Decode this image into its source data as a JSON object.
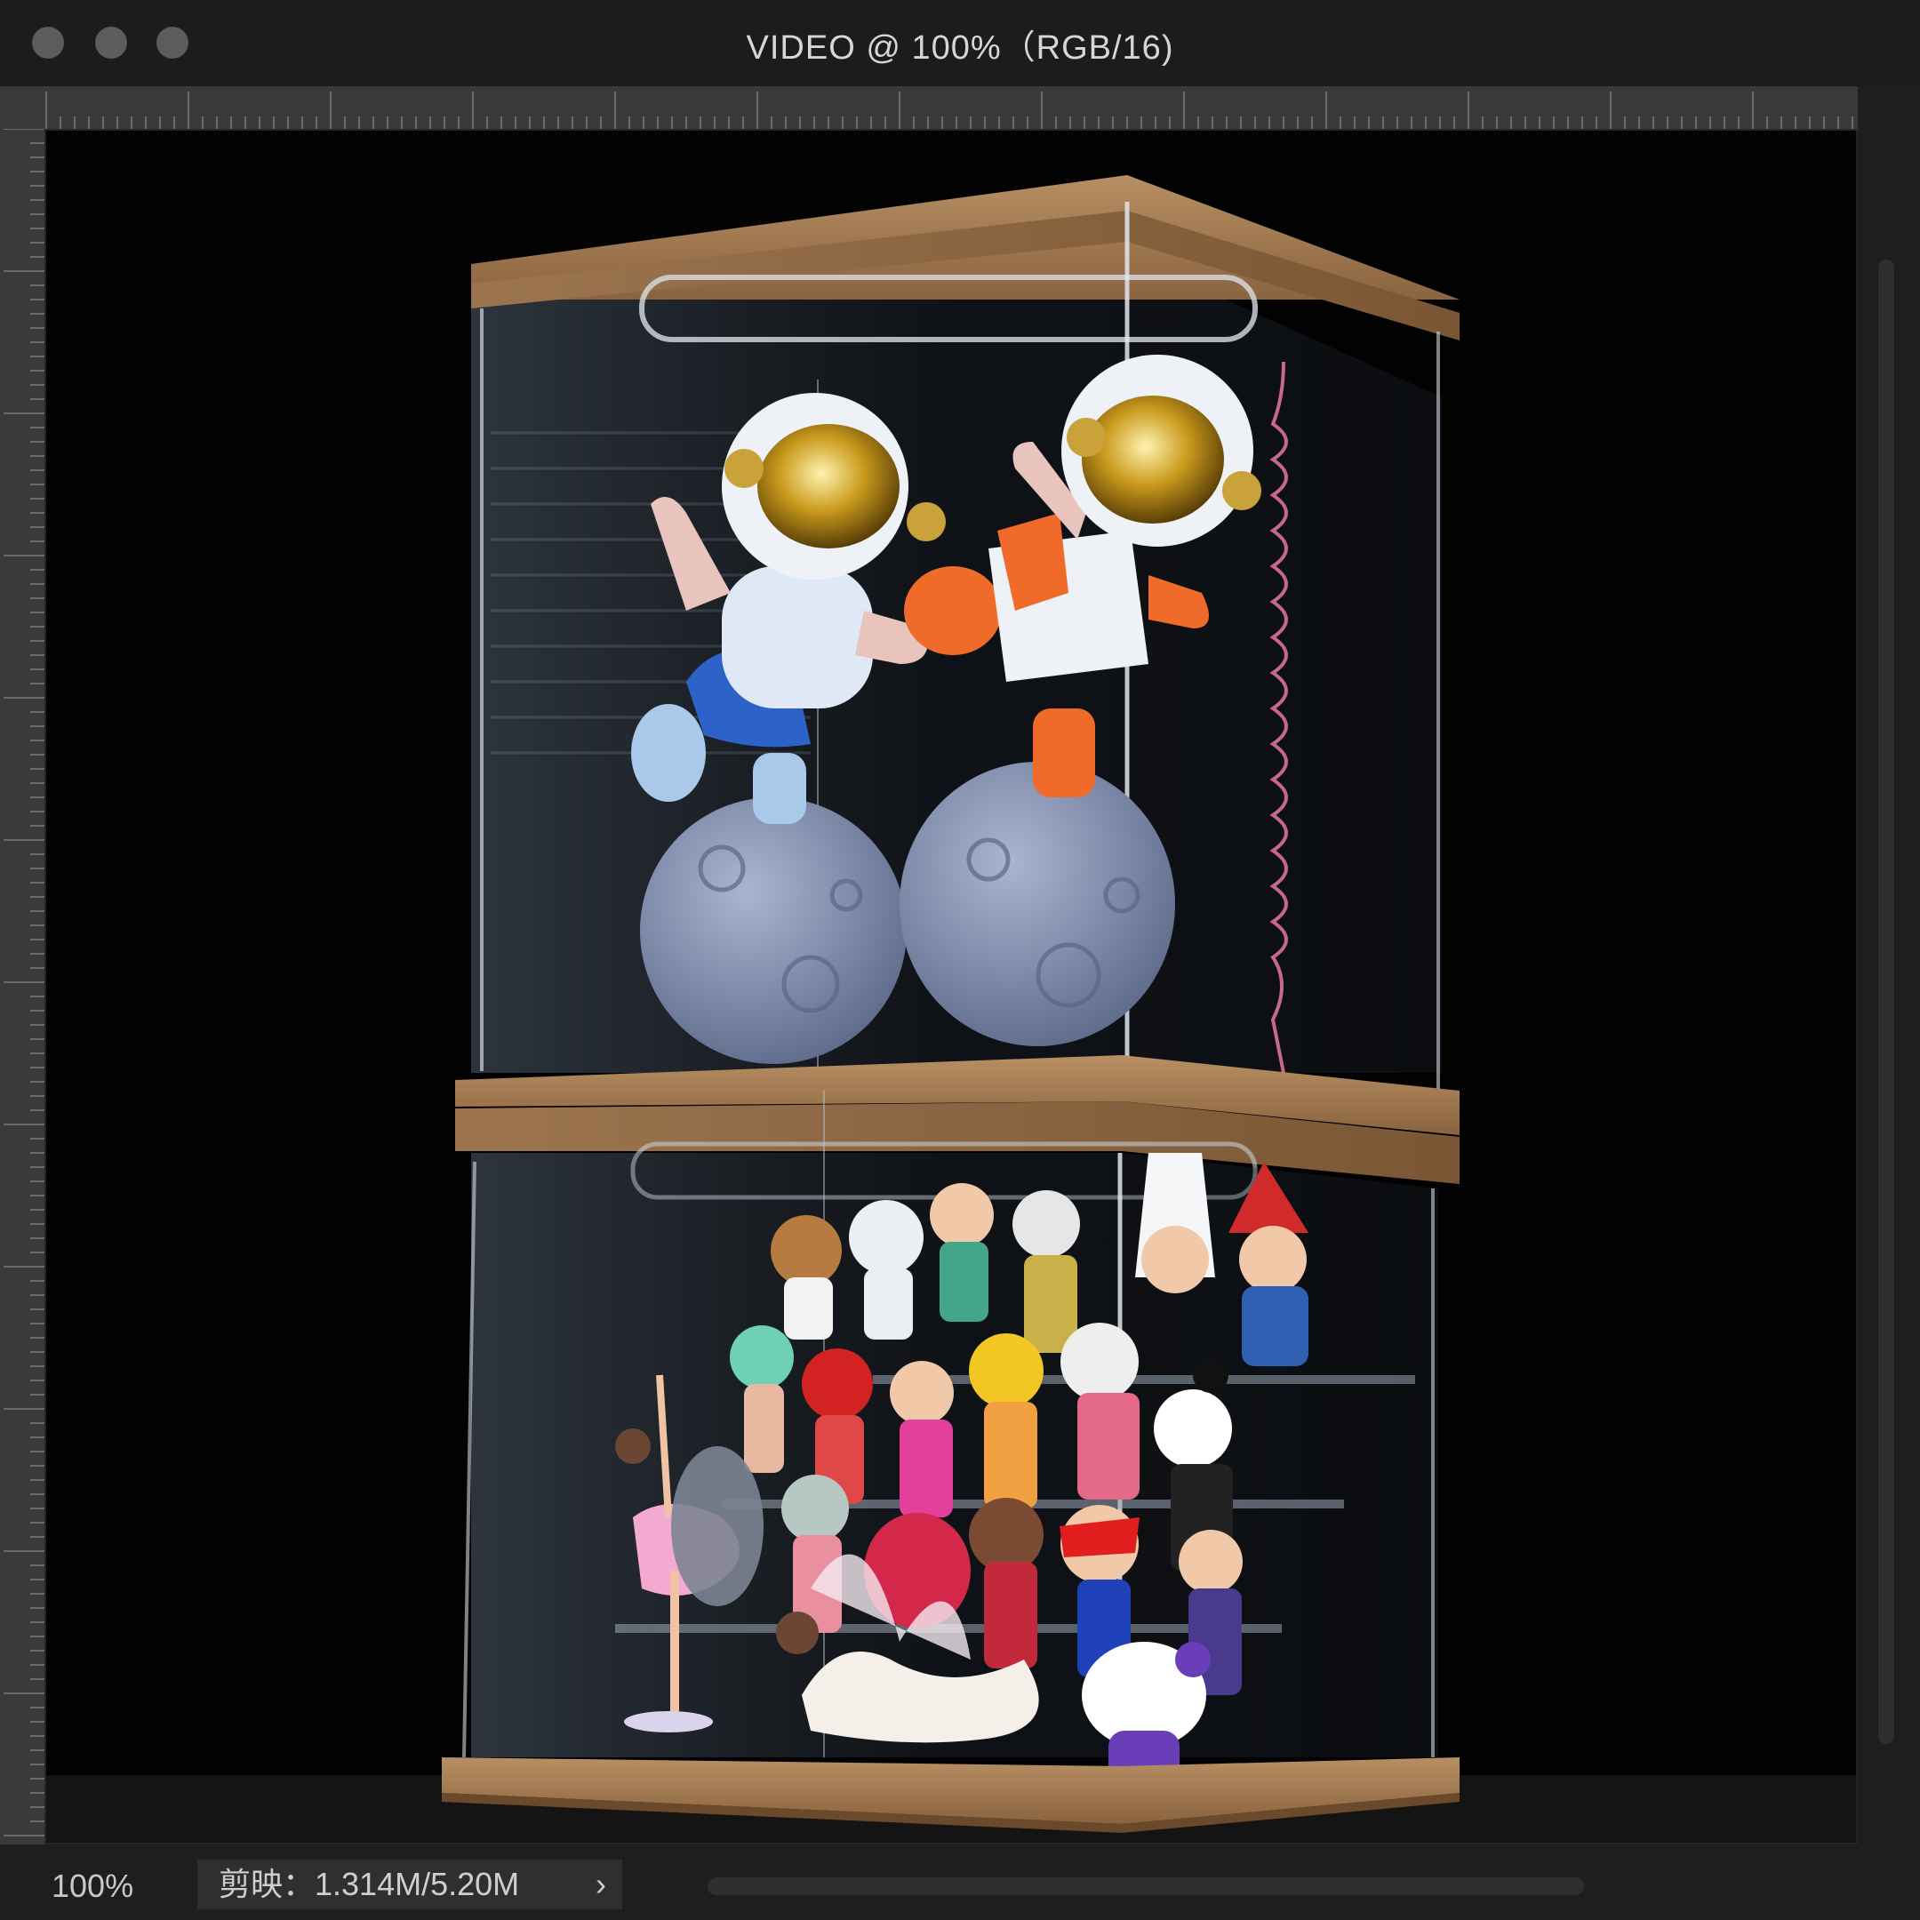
{
  "window": {
    "title": "VIDEO @ 100%（RGB/16)",
    "traffic_lights": [
      "close",
      "minimize",
      "zoom"
    ]
  },
  "canvas": {
    "image_description_icon": "image-canvas"
  },
  "status_bar": {
    "zoom_level": "100%",
    "doc_info": "剪映：1.314M/5.20M",
    "doc_info_menu_icon": "chevron-right-icon"
  },
  "colors": {
    "titlebar": "#1c1c1c",
    "ruler": "#3a3a3a",
    "canvas_bg": "#020203",
    "wood": "#a07a52"
  }
}
